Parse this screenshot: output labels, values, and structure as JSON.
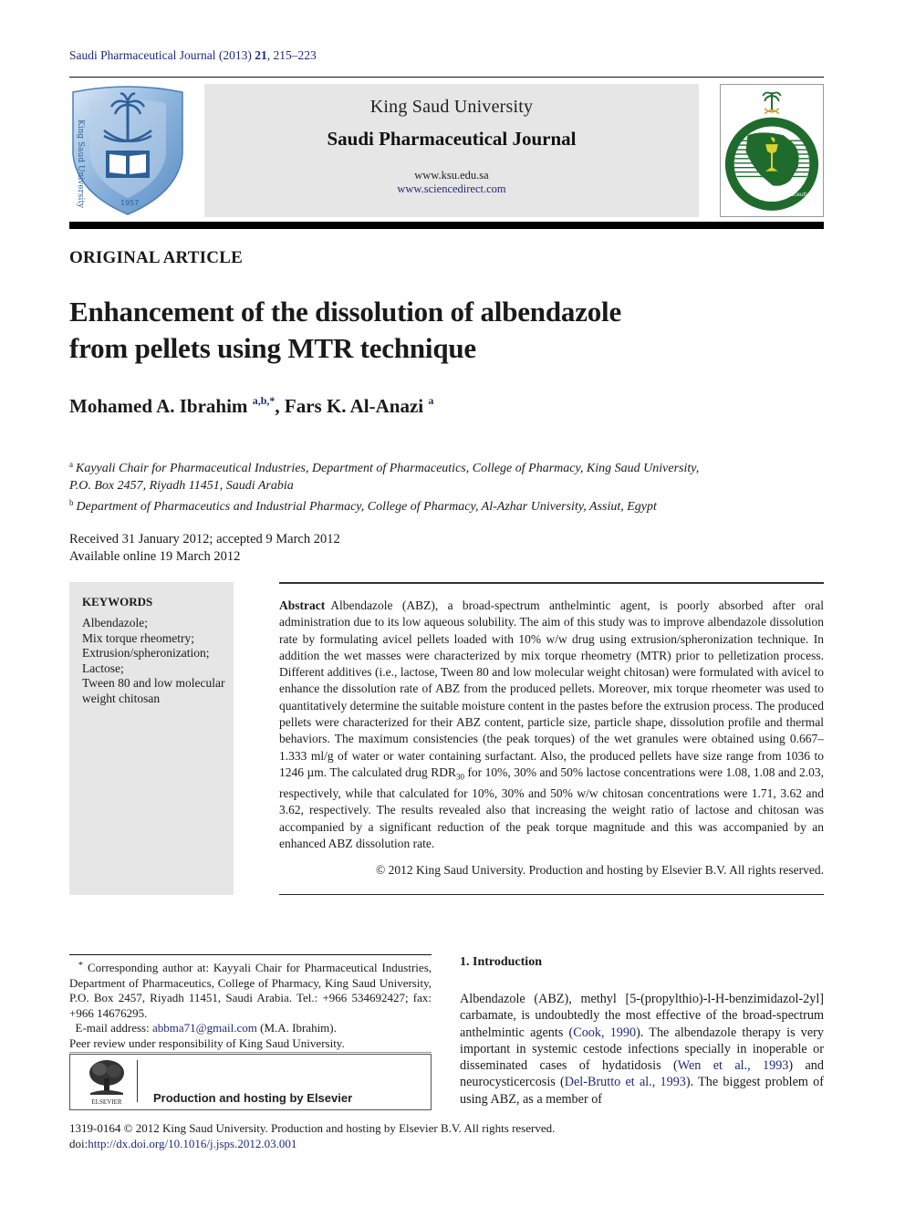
{
  "running_head": {
    "journal": "Saudi Pharmaceutical Journal (2013)",
    "volume": "21",
    "pages": ", 215–223"
  },
  "masthead": {
    "left_logo": "king-saud-university-crest",
    "university": "King Saud University",
    "journal": "Saudi Pharmaceutical Journal",
    "url_ksu": "www.ksu.edu.sa",
    "url_sciencedirect": "www.sciencedirect.com",
    "right_logo": "saudi-pharmaceutical-society-emblem"
  },
  "article": {
    "type": "ORIGINAL ARTICLE",
    "title_line1": "Enhancement of the dissolution of albendazole",
    "title_line2": "from pellets using MTR technique",
    "authors": [
      {
        "name": "Mohamed A. Ibrahim",
        "marks": "a,b,*"
      },
      {
        "name": "Fars K. Al-Anazi",
        "marks": "a"
      }
    ],
    "author_separator": ", ",
    "affiliations": [
      {
        "mark": "a",
        "line1": "Kayyali Chair for Pharmaceutical Industries, Department of Pharmaceutics, College of Pharmacy, King Saud University,",
        "line2": "P.O. Box 2457, Riyadh 11451, Saudi Arabia"
      },
      {
        "mark": "b",
        "line1": "Department of Pharmaceutics and Industrial Pharmacy, College of Pharmacy, Al-Azhar University, Assiut, Egypt"
      }
    ],
    "received": "Received 31 January 2012; accepted 9 March 2012",
    "available": "Available online 19 March 2012"
  },
  "keywords": {
    "heading": "KEYWORDS",
    "items": [
      "Albendazole;",
      "Mix torque rheometry;",
      "Extrusion/spheronization;",
      "Lactose;",
      "Tween 80 and low molecular weight chitosan"
    ]
  },
  "abstract": {
    "label": "Abstract",
    "text_part1": "Albendazole (ABZ), a broad-spectrum anthelmintic agent, is poorly absorbed after oral administration due to its low aqueous solubility. The aim of this study was to improve albendazole dissolution rate by formulating avicel pellets loaded with 10% w/w drug using extrusion/spheronization technique. In addition the wet masses were characterized by mix torque rheometry (MTR) prior to pelletization process. Different additives (i.e., lactose, Tween 80 and low molecular weight chitosan) were formulated with avicel to enhance the dissolution rate of ABZ from the produced pellets. Moreover, mix torque rheometer was used to quantitatively determine the suitable moisture content in the pastes before the extrusion process. The produced pellets were characterized for their ABZ content, particle size, particle shape, dissolution profile and thermal behaviors. The maximum consistencies (the peak torques) of the wet granules were obtained using 0.667–1.333 ml/g of water or water containing surfactant. Also, the produced pellets have size range from 1036 to 1246 µm. The calculated drug RDR",
    "subscript": "30",
    "text_part2": " for 10%, 30% and 50% lactose concentrations were 1.08, 1.08 and 2.03, respectively, while that calculated for 10%, 30% and 50% w/w chitosan concentrations were 1.71, 3.62 and 3.62, respectively. The results revealed also that increasing the weight ratio of lactose and chitosan was accompanied by a significant reduction of the peak torque magnitude and this was accompanied by an enhanced ABZ dissolution rate.",
    "copyright": "© 2012 King Saud University. Production and hosting by Elsevier B.V. All rights reserved."
  },
  "footnote": {
    "mark": "*",
    "corresponding": "Corresponding author at: Kayyali Chair for Pharmaceutical Industries, Department of Pharmaceutics, College of Pharmacy, King Saud University, P.O. Box 2457, Riyadh 11451, Saudi Arabia. Tel.: +966 534692427; fax: +966 14676295.",
    "email_label": "E-mail address: ",
    "email": "abbma71@gmail.com",
    "email_suffix": " (M.A. Ibrahim).",
    "peer_review": "Peer review under responsibility of King Saud University."
  },
  "elsevier": {
    "logo_label": "ELSEVIER",
    "text": "Production and hosting by Elsevier"
  },
  "introduction": {
    "heading": "1. Introduction",
    "text_a": "Albendazole (ABZ), methyl [5-(propylthio)-l-H-benzimidazol-2yl] carbamate, is undoubtedly the most effective of the broad-spectrum anthelmintic agents (",
    "ref1": "Cook, 1990",
    "text_b": "). The albendazole therapy is very important in systemic cestode infections specially in inoperable or disseminated cases of hydatidosis (",
    "ref2": "Wen et al., 1993",
    "text_c": ") and neurocysticercosis (",
    "ref3": "Del-Brutto et al., 1993",
    "text_d": "). The biggest problem of using ABZ, as a member of"
  },
  "footer": {
    "issn_line": "1319-0164 © 2012 King Saud University. Production and hosting by Elsevier B.V. All rights reserved.",
    "doi_label": "doi:",
    "doi_url": "http://dx.doi.org/10.1016/j.jsps.2012.03.001"
  },
  "colors": {
    "link": "#1f2a7a",
    "panel_gray": "#e6e6e6",
    "ksu_blue": "#6f9fd0",
    "sps_green": "#1f6b2e",
    "sps_yellow": "#d9d42a"
  }
}
